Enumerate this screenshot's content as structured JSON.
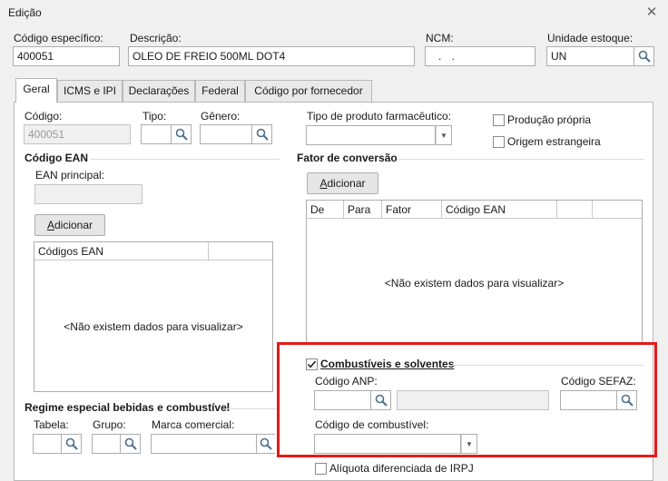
{
  "window": {
    "title": "Edição",
    "close_icon": "close-icon"
  },
  "header": {
    "codigo_label": "Código específico:",
    "codigo_value": "400051",
    "descricao_label": "Descrição:",
    "descricao_value": "OLEO DE FREIO 500ML DOT4",
    "ncm_label": "NCM:",
    "ncm_value": ". .",
    "unidade_label": "Unidade estoque:",
    "unidade_value": "UN"
  },
  "tabs": [
    {
      "label": "Geral",
      "active": true
    },
    {
      "label": "ICMS e IPI",
      "active": false
    },
    {
      "label": "Declarações",
      "active": false
    },
    {
      "label": "Federal",
      "active": false
    },
    {
      "label": "Código por fornecedor",
      "active": false
    }
  ],
  "geral": {
    "codigo_label": "Código:",
    "codigo_value": "400051",
    "tipo_label": "Tipo:",
    "genero_label": "Gênero:",
    "tipo_farm_label": "Tipo de produto farmacêutico:",
    "producao_propria_label": "Produção própria",
    "origem_estrangeira_label": "Origem estrangeira"
  },
  "ean": {
    "section_title": "Código EAN",
    "principal_label": "EAN principal:",
    "add_label_first": "A",
    "add_label_rest": "dicionar",
    "grid_header": "Códigos EAN",
    "empty_text": "<Não existem dados para visualizar>"
  },
  "fator": {
    "section_title": "Fator de conversão",
    "add_label_first": "A",
    "add_label_rest": "dicionar",
    "columns": [
      "De",
      "Para",
      "Fator",
      "Código EAN"
    ],
    "empty_text": "<Não existem dados para visualizar>"
  },
  "combustiveis": {
    "checkbox_label": "Combustíveis e solventes",
    "checked": true,
    "anp_label": "Código ANP:",
    "sefaz_label": "Código SEFAZ:",
    "combustivel_label": "Código de combustível:",
    "aliquota_label": "Alíquota diferenciada de IRPJ"
  },
  "regime": {
    "section_title": "Regime especial bebidas e combustível",
    "tabela_label": "Tabela:",
    "grupo_label": "Grupo:",
    "marca_label": "Marca comercial:"
  },
  "colors": {
    "highlight": "#e31b1b",
    "background": "#f0f0f0",
    "border": "#adadad"
  }
}
